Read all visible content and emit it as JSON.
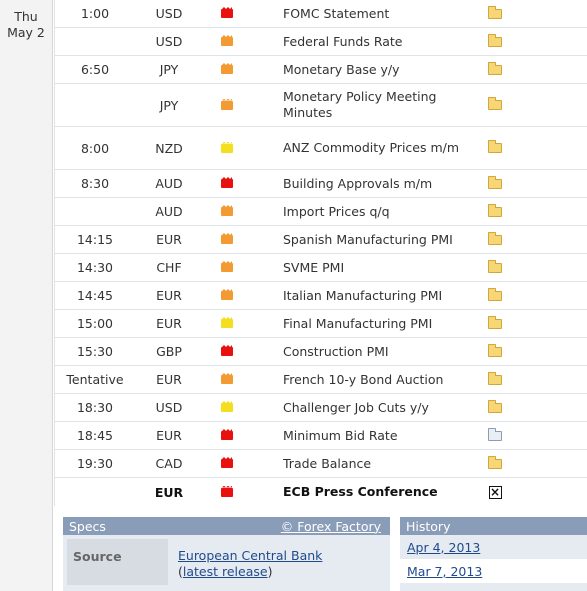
{
  "date": {
    "weekday": "Thu",
    "day": "May 2"
  },
  "colors": {
    "high": "#e8110f",
    "medium": "#f39a33",
    "low": "#f3df1f",
    "panel_header": "#8a9db8",
    "link": "#1f4b8c"
  },
  "events": [
    {
      "time": "1:00",
      "currency": "USD",
      "impact": "high",
      "event": "FOMC Statement",
      "detail_icon": "folder-icon"
    },
    {
      "time": "",
      "currency": "USD",
      "impact": "medium",
      "event": "Federal Funds Rate",
      "detail_icon": "folder-icon"
    },
    {
      "time": "6:50",
      "currency": "JPY",
      "impact": "medium",
      "event": "Monetary Base y/y",
      "detail_icon": "folder-icon"
    },
    {
      "time": "",
      "currency": "JPY",
      "impact": "medium",
      "event": "Monetary Policy Meeting Minutes",
      "detail_icon": "folder-icon"
    },
    {
      "time": "8:00",
      "currency": "NZD",
      "impact": "low",
      "event": "ANZ Commodity Prices m/m",
      "detail_icon": "folder-icon"
    },
    {
      "time": "8:30",
      "currency": "AUD",
      "impact": "high",
      "event": "Building Approvals m/m",
      "detail_icon": "folder-icon"
    },
    {
      "time": "",
      "currency": "AUD",
      "impact": "medium",
      "event": "Import Prices q/q",
      "detail_icon": "folder-icon"
    },
    {
      "time": "14:15",
      "currency": "EUR",
      "impact": "medium",
      "event": "Spanish Manufacturing PMI",
      "detail_icon": "folder-icon"
    },
    {
      "time": "14:30",
      "currency": "CHF",
      "impact": "medium",
      "event": "SVME PMI",
      "detail_icon": "folder-icon"
    },
    {
      "time": "14:45",
      "currency": "EUR",
      "impact": "medium",
      "event": "Italian Manufacturing PMI",
      "detail_icon": "folder-icon"
    },
    {
      "time": "15:00",
      "currency": "EUR",
      "impact": "low",
      "event": "Final Manufacturing PMI",
      "detail_icon": "folder-icon"
    },
    {
      "time": "15:30",
      "currency": "GBP",
      "impact": "high",
      "event": "Construction PMI",
      "detail_icon": "folder-icon"
    },
    {
      "time": "Tentative",
      "currency": "EUR",
      "impact": "medium",
      "event": "French 10-y Bond Auction",
      "detail_icon": "folder-icon"
    },
    {
      "time": "18:30",
      "currency": "USD",
      "impact": "low",
      "event": "Challenger Job Cuts y/y",
      "detail_icon": "folder-icon"
    },
    {
      "time": "18:45",
      "currency": "EUR",
      "impact": "high",
      "event": "Minimum Bid Rate",
      "detail_icon": "document-folder-icon"
    },
    {
      "time": "19:30",
      "currency": "CAD",
      "impact": "high",
      "event": "Trade Balance",
      "detail_icon": "folder-icon"
    },
    {
      "time": "",
      "currency": "EUR",
      "impact": "high",
      "event": "ECB Press Conference",
      "detail_icon": "close-icon",
      "selected": true
    }
  ],
  "specs": {
    "title": "Specs",
    "credit": "© Forex Factory",
    "source_label": "Source",
    "source_value": "European Central Bank",
    "latest_release": "latest release"
  },
  "history": {
    "title": "History",
    "dates": [
      "Apr 4, 2013",
      "Mar 7, 2013"
    ]
  }
}
